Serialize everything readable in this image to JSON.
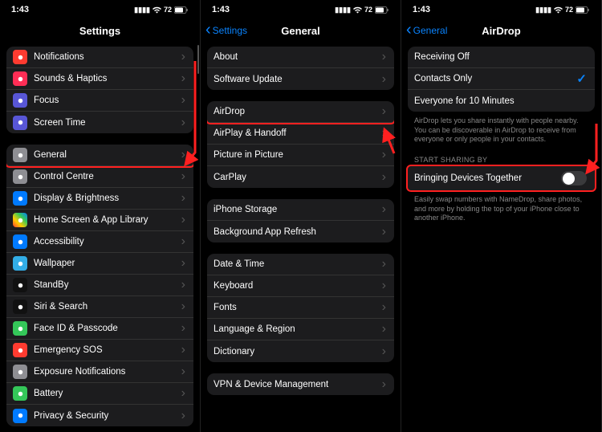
{
  "status": {
    "time": "1:43",
    "battery": "72"
  },
  "phone1": {
    "title": "Settings",
    "groups": [
      [
        {
          "icon": "bell-icon",
          "bg": "bg-red",
          "label": "Notifications"
        },
        {
          "icon": "speaker-icon",
          "bg": "bg-pink",
          "label": "Sounds & Haptics"
        },
        {
          "icon": "moon-icon",
          "bg": "bg-indigo",
          "label": "Focus"
        },
        {
          "icon": "hourglass-icon",
          "bg": "bg-indigo",
          "label": "Screen Time"
        }
      ],
      [
        {
          "icon": "gear-icon",
          "bg": "bg-grey",
          "label": "General",
          "highlight": true
        },
        {
          "icon": "switches-icon",
          "bg": "bg-grey",
          "label": "Control Centre"
        },
        {
          "icon": "sun-icon",
          "bg": "bg-blue",
          "label": "Display & Brightness"
        },
        {
          "icon": "grid-icon",
          "bg": "bg-multi",
          "label": "Home Screen & App Library"
        },
        {
          "icon": "person-icon",
          "bg": "bg-blue",
          "label": "Accessibility"
        },
        {
          "icon": "flower-icon",
          "bg": "bg-cyan",
          "label": "Wallpaper"
        },
        {
          "icon": "clock-icon",
          "bg": "bg-black",
          "label": "StandBy"
        },
        {
          "icon": "siri-icon",
          "bg": "bg-black",
          "label": "Siri & Search"
        },
        {
          "icon": "faceid-icon",
          "bg": "bg-green",
          "label": "Face ID & Passcode"
        },
        {
          "icon": "sos-icon",
          "bg": "bg-red",
          "label": "Emergency SOS"
        },
        {
          "icon": "virus-icon",
          "bg": "bg-grey",
          "label": "Exposure Notifications"
        },
        {
          "icon": "battery-icon",
          "bg": "bg-green",
          "label": "Battery"
        },
        {
          "icon": "hand-icon",
          "bg": "bg-blue",
          "label": "Privacy & Security"
        }
      ]
    ]
  },
  "phone2": {
    "back": "Settings",
    "title": "General",
    "groups": [
      [
        {
          "label": "About"
        },
        {
          "label": "Software Update"
        }
      ],
      [
        {
          "label": "AirDrop",
          "highlight": true
        },
        {
          "label": "AirPlay & Handoff"
        },
        {
          "label": "Picture in Picture"
        },
        {
          "label": "CarPlay"
        }
      ],
      [
        {
          "label": "iPhone Storage"
        },
        {
          "label": "Background App Refresh"
        }
      ],
      [
        {
          "label": "Date & Time"
        },
        {
          "label": "Keyboard"
        },
        {
          "label": "Fonts"
        },
        {
          "label": "Language & Region"
        },
        {
          "label": "Dictionary"
        }
      ],
      [
        {
          "label": "VPN & Device Management"
        }
      ]
    ]
  },
  "phone3": {
    "back": "General",
    "title": "AirDrop",
    "options": [
      {
        "label": "Receiving Off",
        "selected": false
      },
      {
        "label": "Contacts Only",
        "selected": true
      },
      {
        "label": "Everyone for 10 Minutes",
        "selected": false
      }
    ],
    "note1": "AirDrop lets you share instantly with people nearby. You can be discoverable in AirDrop to receive from everyone or only people in your contacts.",
    "section_header": "START SHARING BY",
    "toggle_label": "Bringing Devices Together",
    "note2": "Easily swap numbers with NameDrop, share photos, and more by holding the top of your iPhone close to another iPhone."
  }
}
